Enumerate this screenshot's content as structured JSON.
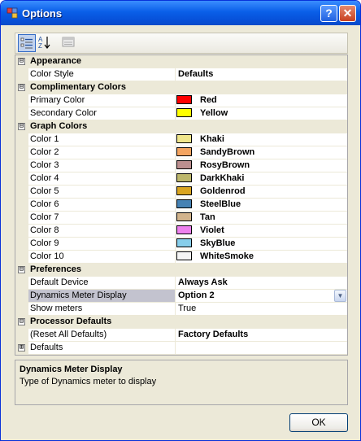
{
  "window": {
    "title": "Options"
  },
  "titlebar": {
    "help_glyph": "?",
    "close_glyph": "✕"
  },
  "toolbar": {
    "icons": [
      "categorized-icon",
      "alphabetical-icon",
      "property-pages-icon"
    ]
  },
  "grid": {
    "rows": [
      {
        "type": "category",
        "label": "Appearance",
        "expander": "⊟"
      },
      {
        "type": "prop",
        "name": "Color Style",
        "value": "Defaults",
        "bold": true
      },
      {
        "type": "category",
        "label": "Complimentary Colors",
        "expander": "⊟"
      },
      {
        "type": "prop",
        "name": "Primary Color",
        "value": "Red",
        "bold": true,
        "swatch": "#ff0000"
      },
      {
        "type": "prop",
        "name": "Secondary Color",
        "value": "Yellow",
        "bold": true,
        "swatch": "#ffff00"
      },
      {
        "type": "category",
        "label": "Graph Colors",
        "expander": "⊟"
      },
      {
        "type": "prop",
        "name": "Color 1",
        "value": "Khaki",
        "bold": true,
        "swatch": "#f0e68c"
      },
      {
        "type": "prop",
        "name": "Color 2",
        "value": "SandyBrown",
        "bold": true,
        "swatch": "#f4a460"
      },
      {
        "type": "prop",
        "name": "Color 3",
        "value": "RosyBrown",
        "bold": true,
        "swatch": "#bc8f8f"
      },
      {
        "type": "prop",
        "name": "Color 4",
        "value": "DarkKhaki",
        "bold": true,
        "swatch": "#bdb76b"
      },
      {
        "type": "prop",
        "name": "Color 5",
        "value": "Goldenrod",
        "bold": true,
        "swatch": "#daa520"
      },
      {
        "type": "prop",
        "name": "Color 6",
        "value": "SteelBlue",
        "bold": true,
        "swatch": "#4682b4"
      },
      {
        "type": "prop",
        "name": "Color 7",
        "value": "Tan",
        "bold": true,
        "swatch": "#d2b48c"
      },
      {
        "type": "prop",
        "name": "Color 8",
        "value": "Violet",
        "bold": true,
        "swatch": "#ee82ee"
      },
      {
        "type": "prop",
        "name": "Color 9",
        "value": "SkyBlue",
        "bold": true,
        "swatch": "#87ceeb"
      },
      {
        "type": "prop",
        "name": "Color 10",
        "value": "WhiteSmoke",
        "bold": true,
        "swatch": "#f5f5f5"
      },
      {
        "type": "category",
        "label": "Preferences",
        "expander": "⊟"
      },
      {
        "type": "prop",
        "name": "Default Device",
        "value": "Always Ask",
        "bold": true
      },
      {
        "type": "prop",
        "name": "Dynamics Meter Display",
        "value": "Option 2",
        "bold": true,
        "selected": true,
        "dropdown": true
      },
      {
        "type": "prop",
        "name": "Show meters",
        "value": "True",
        "bold": false
      },
      {
        "type": "category",
        "label": "Processor Defaults",
        "expander": "⊟"
      },
      {
        "type": "prop",
        "name": "(Reset All Defaults)",
        "value": "Factory Defaults",
        "bold": true
      },
      {
        "type": "prop",
        "name": "Defaults",
        "value": "",
        "bold": false,
        "expandable": true,
        "expander": "⊞"
      }
    ]
  },
  "help": {
    "title": "Dynamics Meter Display",
    "description": "Type of Dynamics meter to display"
  },
  "buttons": {
    "ok_label": "OK"
  }
}
